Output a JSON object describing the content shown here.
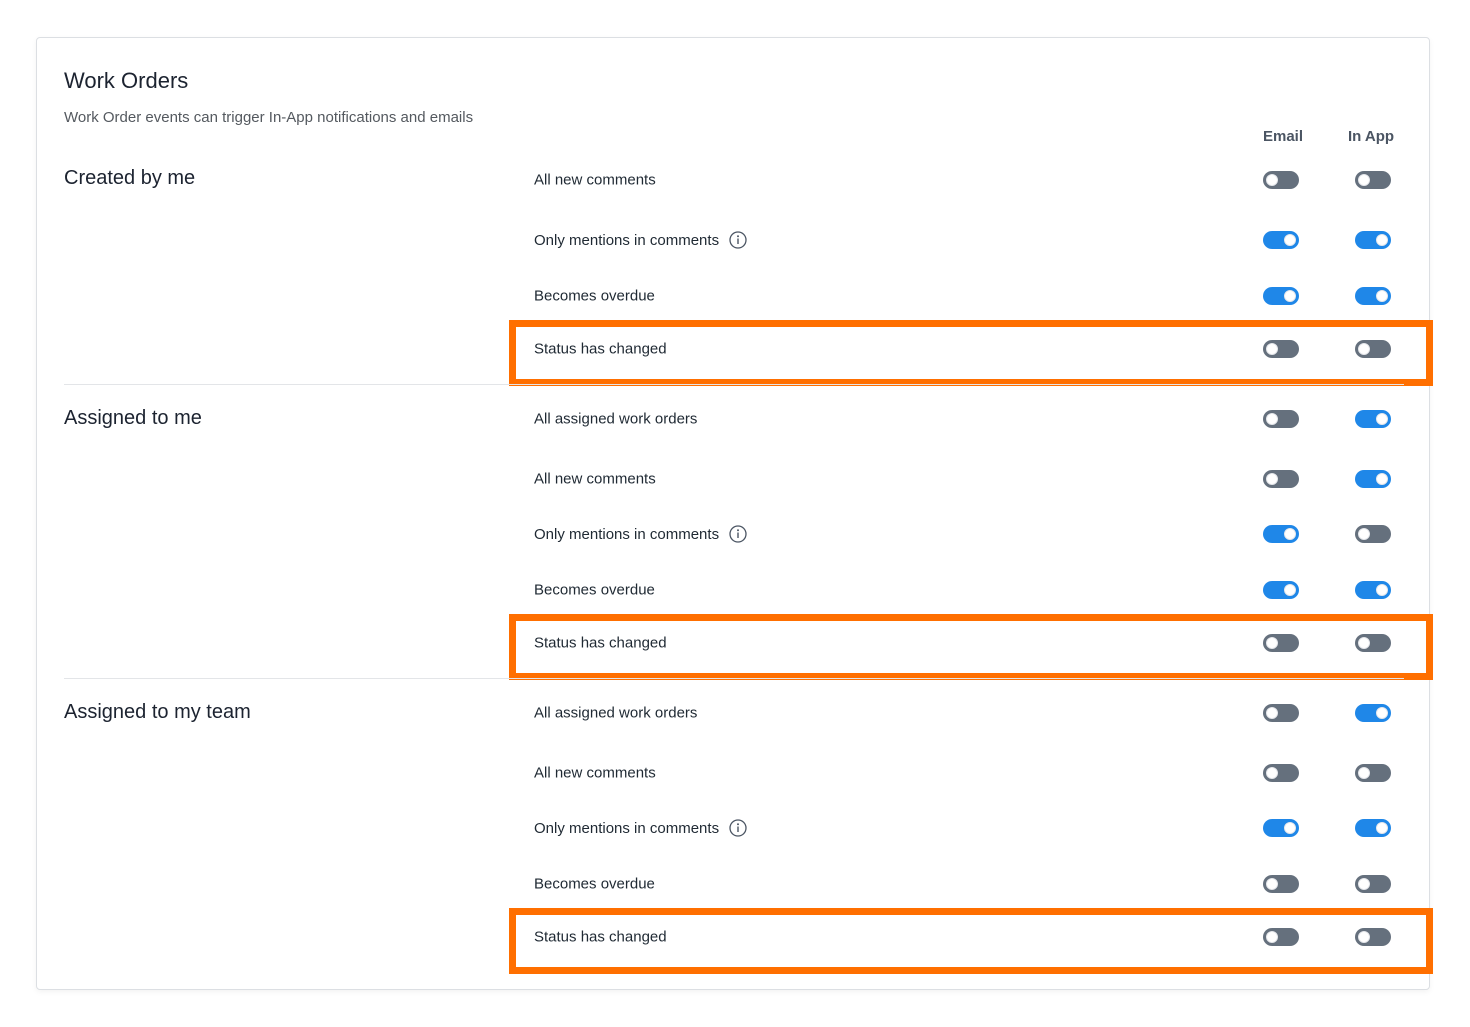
{
  "title": "Work Orders",
  "subtitle": "Work Order events can trigger In-App notifications and emails",
  "columns": {
    "email": "Email",
    "in_app": "In App"
  },
  "highlight_color": "#ff6f00",
  "toggle_on_color": "#1f87e8",
  "toggle_off_color": "#65707d",
  "sections": [
    {
      "title": "Created by me",
      "rows": [
        {
          "label": "All new comments",
          "info": false,
          "email": false,
          "in_app": false
        },
        {
          "label": "Only mentions in comments",
          "info": true,
          "email": true,
          "in_app": true
        },
        {
          "label": "Becomes overdue",
          "info": false,
          "email": true,
          "in_app": true
        },
        {
          "label": "Status has changed",
          "info": false,
          "email": false,
          "in_app": false,
          "highlighted": true
        }
      ]
    },
    {
      "title": "Assigned to me",
      "rows": [
        {
          "label": "All assigned work orders",
          "info": false,
          "email": false,
          "in_app": true
        },
        {
          "label": "All new comments",
          "info": false,
          "email": false,
          "in_app": true
        },
        {
          "label": "Only mentions in comments",
          "info": true,
          "email": true,
          "in_app": false
        },
        {
          "label": "Becomes overdue",
          "info": false,
          "email": true,
          "in_app": true
        },
        {
          "label": "Status has changed",
          "info": false,
          "email": false,
          "in_app": false,
          "highlighted": true
        }
      ]
    },
    {
      "title": "Assigned to my team",
      "rows": [
        {
          "label": "All assigned work orders",
          "info": false,
          "email": false,
          "in_app": true
        },
        {
          "label": "All new comments",
          "info": false,
          "email": false,
          "in_app": false
        },
        {
          "label": "Only mentions in comments",
          "info": true,
          "email": true,
          "in_app": true
        },
        {
          "label": "Becomes overdue",
          "info": false,
          "email": false,
          "in_app": false
        },
        {
          "label": "Status has changed",
          "info": false,
          "email": false,
          "in_app": false,
          "highlighted": true
        }
      ]
    }
  ]
}
